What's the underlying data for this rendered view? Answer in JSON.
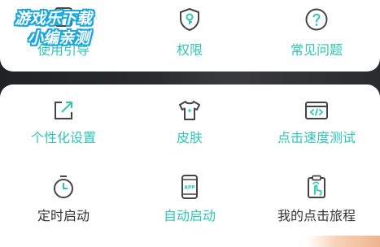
{
  "watermark": {
    "line1": "游戏乐下载",
    "line2": "小编亲测"
  },
  "top_row": [
    {
      "label": "使用引导",
      "icon": "guide-icon"
    },
    {
      "label": "权限",
      "icon": "permission-shield-icon"
    },
    {
      "label": "常见问题",
      "icon": "question-icon"
    }
  ],
  "grid": [
    {
      "label": "个性化设置",
      "icon": "personalize-icon",
      "color": "#2fc6b4"
    },
    {
      "label": "皮肤",
      "icon": "tshirt-skin-icon",
      "color": "#2fc6b4"
    },
    {
      "label": "点击速度测试",
      "icon": "code-window-icon",
      "color": "#2fc6b4"
    },
    {
      "label": "定时启动",
      "icon": "timer-icon",
      "color": "#333333"
    },
    {
      "label": "自动启动",
      "icon": "app-phone-icon",
      "color": "#2fc6b4"
    },
    {
      "label": "我的点击旅程",
      "icon": "tap-clipboard-icon",
      "color": "#333333"
    }
  ],
  "colors": {
    "accent": "#2fc6b4",
    "text_dark": "#333333",
    "icon_stroke": "#444444",
    "icon_green": "#2fc6b4"
  }
}
